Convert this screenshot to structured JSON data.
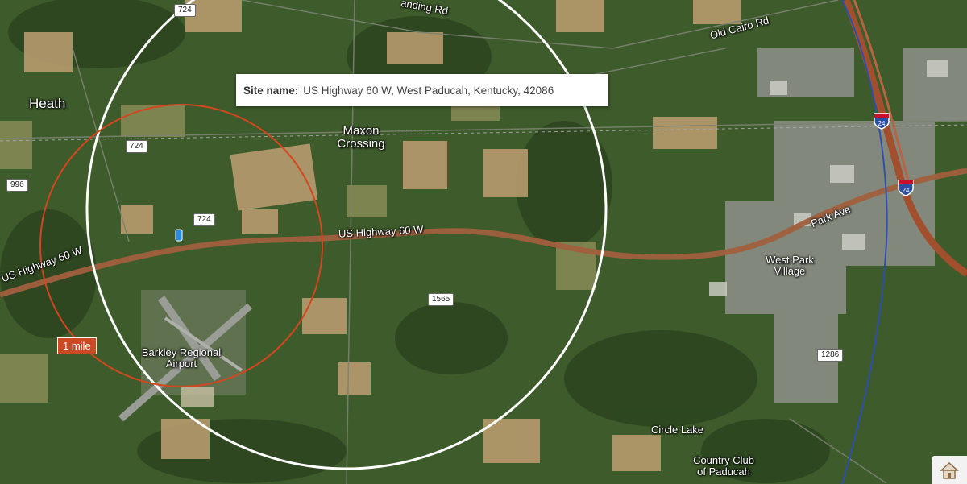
{
  "popup": {
    "label": "Site name:",
    "value": "US Highway 60 W, West Paducah, Kentucky, 42086"
  },
  "places": {
    "heath": "Heath",
    "maxon_line1": "Maxon",
    "maxon_line2": "Crossing",
    "west_park_line1": "West Park",
    "west_park_line2": "Village",
    "airport_line1": "Barkley Regional",
    "airport_line2": "Airport",
    "circle_lake": "Circle Lake",
    "country_club_line1": "Country Club",
    "country_club_line2": "of Paducah"
  },
  "roads": {
    "us60_west": "US Highway 60 W",
    "us60_center": "US Highway 60 W",
    "old_cairo": "Old Cairo Rd",
    "landing": "anding Rd",
    "park_ave": "Park Ave"
  },
  "shields": {
    "r724_top": "724",
    "r724_mid": "724",
    "r724_low": "724",
    "r996": "996",
    "r1565": "1565",
    "r1286": "1286",
    "i24_a": "24",
    "i24_b": "24"
  },
  "scale": {
    "label": "1 mile"
  },
  "colors": {
    "radius_ring": "#d2471f",
    "outer_ring": "#ffffff",
    "highway": "#a0603e",
    "interstate": "#a24f2e",
    "blue_line": "#2d4fb0",
    "badge": "#c94a24"
  },
  "icons": {
    "pin": "map-pin-icon",
    "home": "home-icon"
  }
}
